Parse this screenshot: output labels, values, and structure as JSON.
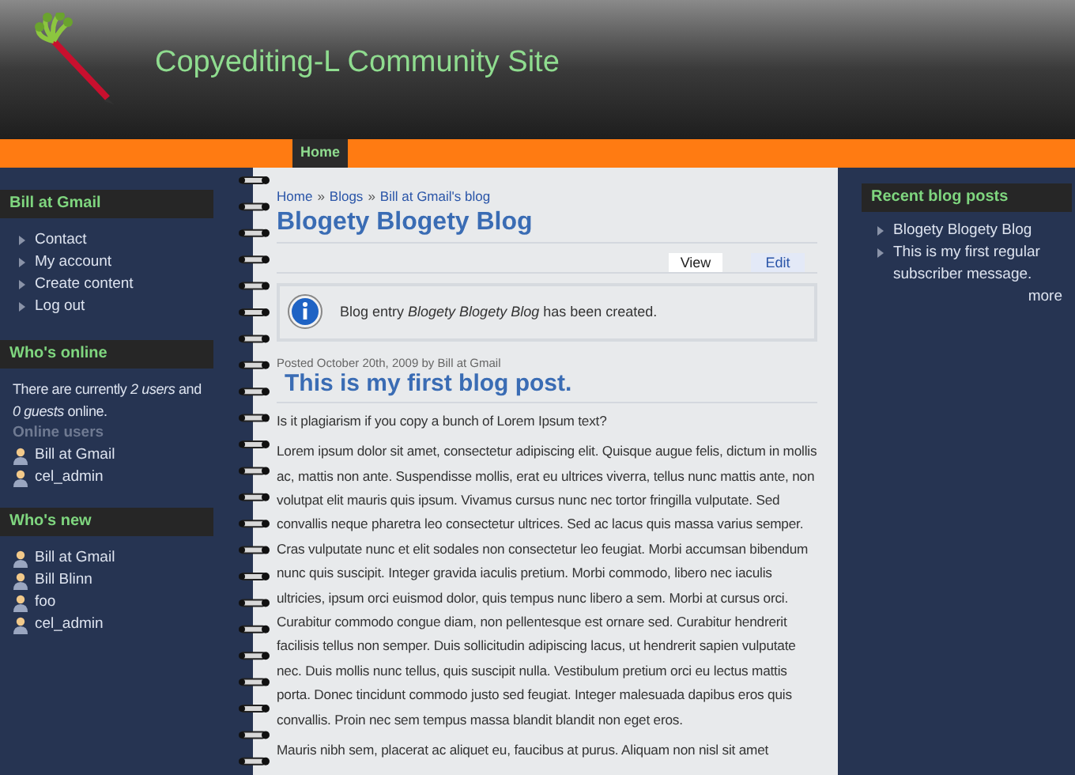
{
  "site": {
    "title": "Copyediting-L Community Site"
  },
  "nav": [
    {
      "label": "Home",
      "selected": true
    }
  ],
  "left_sidebar": [
    {
      "kind": "menu",
      "title": "Bill at Gmail",
      "items": [
        "Contact",
        "My account",
        "Create content",
        "Log out"
      ]
    },
    {
      "kind": "online",
      "title": "Who's online",
      "text": "There are currently *2 users* and *0 guests* online.",
      "subtitle": "Online users",
      "users": [
        "Bill at Gmail",
        "cel_admin"
      ]
    },
    {
      "kind": "users",
      "title": "Who's new",
      "users": [
        "Bill at Gmail",
        "Bill Blinn",
        "foo",
        "cel_admin"
      ]
    }
  ],
  "breadcrumb": {
    "separator": "»",
    "links": [
      "Home",
      "Blogs",
      "Bill at Gmail's blog"
    ]
  },
  "page_title": "Blogety Blogety Blog",
  "tabs": [
    {
      "label": "View",
      "selected": true
    },
    {
      "label": "Edit",
      "selected": false
    }
  ],
  "message": "Blog entry *Blogety Blogety Blog* has been created.",
  "post": {
    "meta": "Posted October 20th, 2009 by Bill at Gmail",
    "title": "This is my first blog post.",
    "paragraphs": [
      "Is it plagiarism if you copy a bunch of Lorem Ipsum text?",
      "Lorem ipsum dolor sit amet, consectetur adipiscing elit. Quisque augue felis, dictum in mollis ac, mattis non ante. Suspendisse mollis, erat eu ultrices viverra, tellus nunc mattis ante, non volutpat elit mauris quis ipsum. Vivamus cursus nunc nec tortor fringilla vulputate. Sed convallis neque pharetra leo consectetur ultrices. Sed ac lacus quis massa varius semper. Cras vulputate nunc et elit sodales non consectetur leo feugiat. Morbi accumsan bibendum nunc quis suscipit. Integer gravida iaculis pretium. Morbi commodo, libero nec iaculis ultricies, ipsum orci euismod dolor, quis tempus nunc libero a sem. Morbi at cursus orci. Curabitur commodo congue diam, non pellentesque est ornare sed. Curabitur hendrerit facilisis tellus non semper. Duis sollicitudin adipiscing lacus, ut hendrerit sapien vulputate nec. Duis mollis nunc tellus, quis suscipit nulla. Vestibulum pretium orci eu lectus mattis porta. Donec tincidunt commodo justo sed feugiat. Integer malesuada dapibus eros quis convallis. Proin nec sem tempus massa blandit blandit non eget eros.",
      "Mauris nibh sem, placerat ac aliquet eu, faucibus at purus. Aliquam non nisl sit amet"
    ]
  },
  "right_sidebar": {
    "title": "Recent blog posts",
    "items": [
      "Blogety Blogety Blog",
      "This is my first regular subscriber message."
    ],
    "more": "more"
  }
}
